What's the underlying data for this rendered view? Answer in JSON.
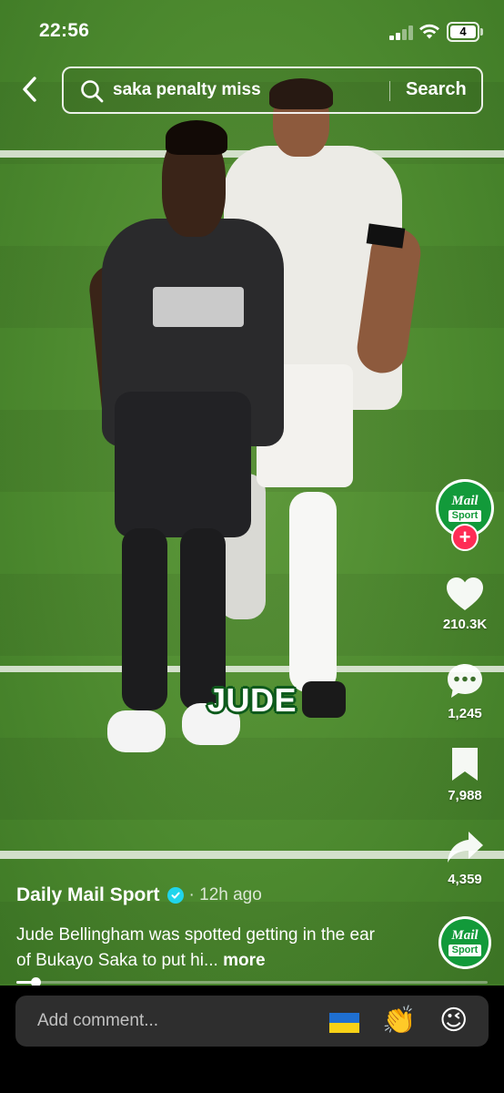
{
  "status_bar": {
    "time": "22:56",
    "battery_level": "4",
    "icons": [
      "cellular-signal-icon",
      "wifi-icon",
      "battery-icon"
    ]
  },
  "header": {
    "back_icon": "chevron-left-icon",
    "search_query": "saka penalty miss",
    "search_button": "Search"
  },
  "video": {
    "caption_word": "JUDE"
  },
  "actions": {
    "account_logo": {
      "line1": "Mail",
      "line2": "Sport"
    },
    "likes": "210.3K",
    "comments": "1,245",
    "saves": "7,988",
    "shares": "4,359"
  },
  "post": {
    "author": "Daily Mail Sport",
    "time_ago": "· 12h ago",
    "description": "Jude Bellingham was spotted getting in the ear of Bukayo Saka to put hi...",
    "more_label": "more",
    "progress_percent": 4
  },
  "comment_bar": {
    "placeholder": "Add comment...",
    "emojis": [
      "🇺🇦",
      "👏",
      "😉"
    ]
  },
  "colors": {
    "mail_green": "#129a3a",
    "follow_red": "#fe2c55",
    "verified_blue": "#20d5ec"
  }
}
